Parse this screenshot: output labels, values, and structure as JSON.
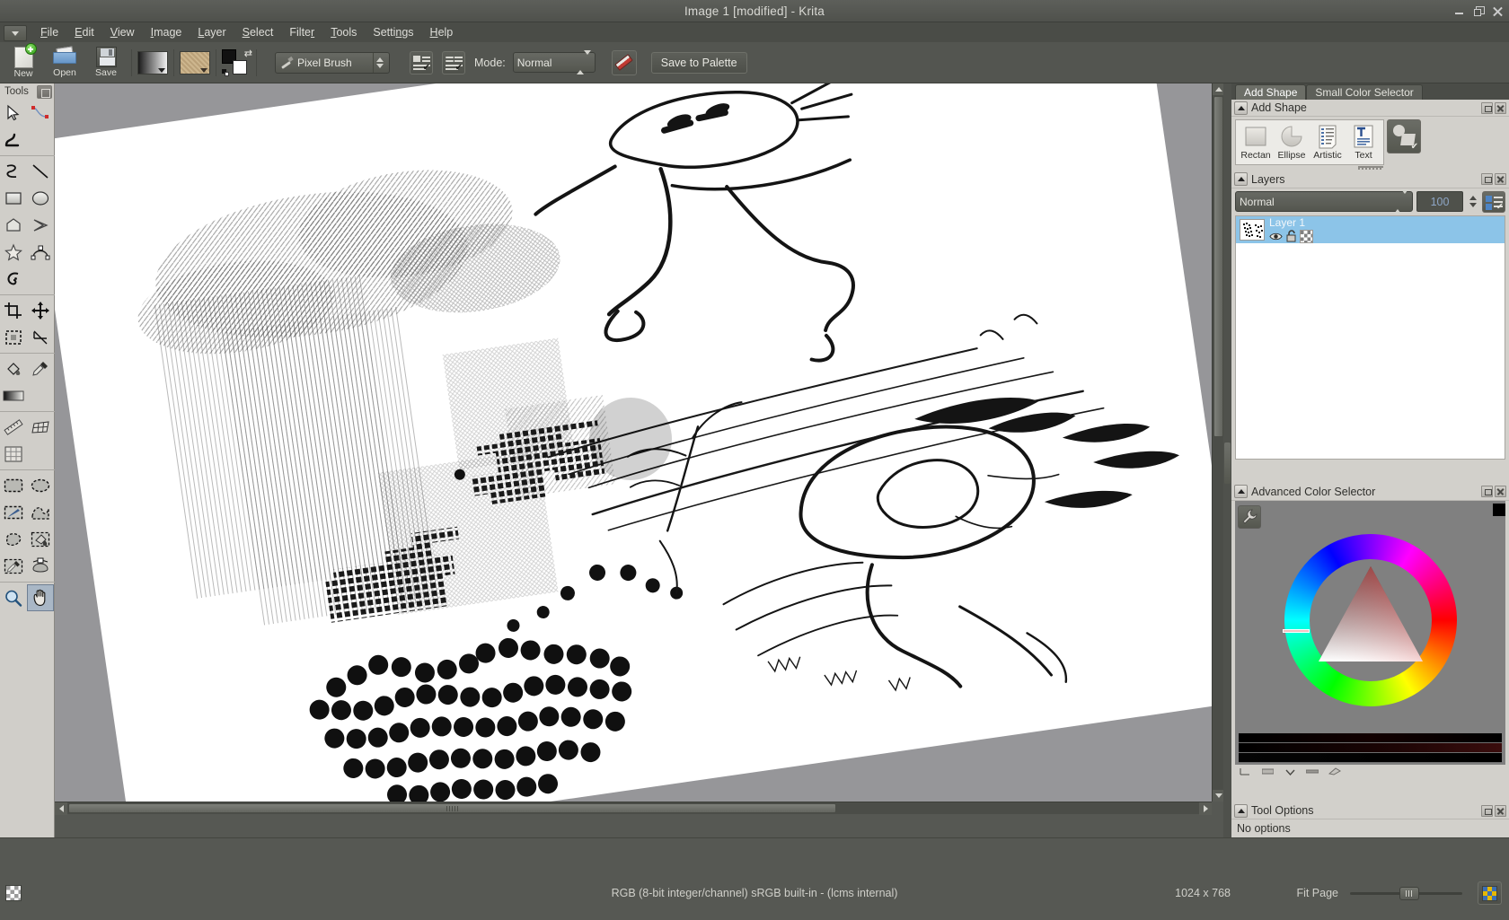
{
  "window": {
    "title": "Image 1 [modified] - Krita",
    "buttons": {
      "minimize": "minimize-button",
      "maximize": "maximize-button",
      "close": "close-button"
    }
  },
  "menubar": {
    "items": [
      {
        "label": "File",
        "mnemonic": "F"
      },
      {
        "label": "Edit",
        "mnemonic": "E"
      },
      {
        "label": "View",
        "mnemonic": "V"
      },
      {
        "label": "Image",
        "mnemonic": "I"
      },
      {
        "label": "Layer",
        "mnemonic": "L"
      },
      {
        "label": "Select",
        "mnemonic": "S"
      },
      {
        "label": "Filter",
        "mnemonic": "r"
      },
      {
        "label": "Tools",
        "mnemonic": "T"
      },
      {
        "label": "Settings",
        "mnemonic": "n"
      },
      {
        "label": "Help",
        "mnemonic": "H"
      }
    ]
  },
  "toolbar": {
    "new_label": "New",
    "open_label": "Open",
    "save_label": "Save",
    "gradient_icon": "gradient-swatch",
    "pattern_icon": "pattern-swatch",
    "fgbg_icon": "foreground-background-color",
    "brush_preset": "Pixel Brush",
    "preset_editor_icon": "brush-preset-editor-icon",
    "preset_selection_icon": "brush-preset-selection-icon",
    "mode_label": "Mode:",
    "blending_mode": "Normal",
    "eraser_icon": "eraser-icon",
    "save_to_palette": "Save to Palette"
  },
  "toolbox": {
    "title": "Tools",
    "grip_icon": "dock-grip-icon",
    "tools": [
      {
        "name": "shape-select-tool",
        "icon": "cursor-arrow-icon",
        "active": false
      },
      {
        "name": "edit-shapes-tool",
        "icon": "path-node-icon",
        "active": false
      },
      {
        "name": "calligraphy-tool",
        "icon": "calligraphy-icon",
        "active": false
      },
      {
        "name": "freehand-path-tool",
        "icon": "freehand-curve-icon",
        "active": false
      },
      {
        "name": "line-tool",
        "icon": "line-icon",
        "active": false
      },
      {
        "name": "rectangle-tool",
        "icon": "rectangle-icon",
        "active": false
      },
      {
        "name": "ellipse-tool",
        "icon": "ellipse-icon",
        "active": false
      },
      {
        "name": "polygon-tool",
        "icon": "polygon-icon",
        "active": false
      },
      {
        "name": "polyline-tool",
        "icon": "polyline-icon",
        "active": false
      },
      {
        "name": "star-tool",
        "icon": "star-icon",
        "active": false
      },
      {
        "name": "bezier-curve-tool",
        "icon": "bezier-curve-icon",
        "active": false
      },
      {
        "name": "dynamic-brush-tool",
        "icon": "dynamic-brush-icon",
        "active": false
      },
      {
        "name": "crop-tool",
        "icon": "crop-icon",
        "active": false
      },
      {
        "name": "move-tool",
        "icon": "move-cross-icon",
        "active": false
      },
      {
        "name": "transform-tool",
        "icon": "transform-icon",
        "active": false
      },
      {
        "name": "measure-angle-tool",
        "icon": "measure-angle-icon",
        "active": false
      },
      {
        "name": "fill-tool",
        "icon": "paint-bucket-icon",
        "active": false
      },
      {
        "name": "color-picker-tool",
        "icon": "eyedropper-icon",
        "active": false
      },
      {
        "name": "gradient-tool",
        "icon": "gradient-bar-icon",
        "active": false
      },
      {
        "name": "measure-tool",
        "icon": "ruler-icon",
        "active": false
      },
      {
        "name": "perspective-grid-tool",
        "icon": "perspective-grid-icon",
        "active": false
      },
      {
        "name": "grid-tool",
        "icon": "grid-icon",
        "active": false
      },
      {
        "name": "rectangular-selection-tool",
        "icon": "select-rectangle-icon",
        "active": false
      },
      {
        "name": "elliptical-selection-tool",
        "icon": "select-ellipse-icon",
        "active": false
      },
      {
        "name": "brush-selection-tool",
        "icon": "select-brush-icon",
        "active": false
      },
      {
        "name": "polygonal-selection-tool",
        "icon": "select-polygon-icon",
        "active": false
      },
      {
        "name": "contiguous-selection-tool",
        "icon": "select-outline-icon",
        "active": false
      },
      {
        "name": "magnetic-selection-tool",
        "icon": "select-magnetic-icon",
        "active": false
      },
      {
        "name": "similar-color-selection-tool",
        "icon": "select-similar-color-icon",
        "active": false
      },
      {
        "name": "bezier-selection-tool",
        "icon": "select-bezier-icon",
        "active": false
      },
      {
        "name": "zoom-tool",
        "icon": "magnifier-icon",
        "active": false
      },
      {
        "name": "pan-tool",
        "icon": "hand-icon",
        "active": true
      }
    ]
  },
  "canvas": {
    "artwork_description": "Hand-drawn sketch on white rotated canvas: cross-hatched rain cloud, pixelated dotted blocks, and brush-stroke creatures",
    "brush_cursor": "circular-brush-cursor"
  },
  "right_dock": {
    "tabs": [
      {
        "label": "Add Shape",
        "mnemonic": "A",
        "selected": true
      },
      {
        "label": "Small Color Selector",
        "mnemonic": "C",
        "selected": false
      }
    ],
    "add_shape": {
      "title": "Add Shape",
      "shapes": [
        {
          "label": "Rectan",
          "icon": "rectangle-shape-icon"
        },
        {
          "label": "Ellipse",
          "icon": "ellipse-shape-icon"
        },
        {
          "label": "Artistic",
          "icon": "artistic-text-icon"
        },
        {
          "label": "Text",
          "icon": "text-shape-icon"
        }
      ],
      "more_shapes_icon": "more-shapes-icon"
    },
    "layers": {
      "title": "Layers",
      "blending_mode": "Normal",
      "opacity": "100",
      "properties_icon": "layer-properties-icon",
      "rows": [
        {
          "name": "Layer 1",
          "visible_icon": "eye-icon",
          "lock_icon": "lock-icon",
          "alpha_icon": "alpha-lock-icon",
          "selected": true
        }
      ]
    },
    "advanced_color_selector": {
      "title": "Advanced Color Selector",
      "settings_icon": "wrench-icon",
      "hue_wheel_icon": "hue-ring",
      "sv_triangle_icon": "saturation-value-triangle",
      "current_color": "#c94a4a",
      "black_swatch": "#000000"
    },
    "tool_options": {
      "title": "Tool Options",
      "content": "No options"
    }
  },
  "statusbar": {
    "selection_icon": "selection-mask-icon",
    "color_info": "RGB (8-bit integer/channel)  sRGB built-in - (lcms internal)",
    "dimensions": "1024 x 768",
    "zoom_label": "Fit Page",
    "zoom_slider": "zoom-slider",
    "grid_button_icon": "canvas-overview-icon"
  },
  "colors": {
    "chrome": "#565853",
    "dock_bg": "#d2d0cb",
    "toolbox_bg": "#d0cec9",
    "canvas_bg": "#969699",
    "selection_blue": "#8cc4e8",
    "accent_text": "#8ea6c6"
  }
}
